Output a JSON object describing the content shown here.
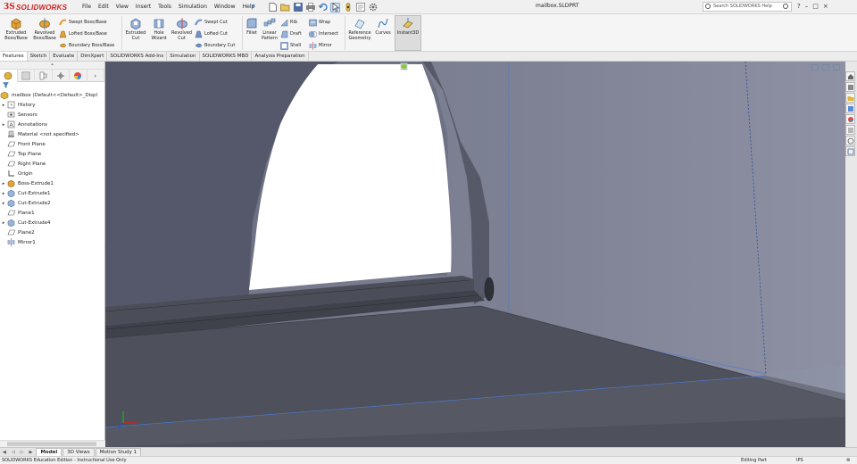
{
  "app": {
    "name": "SOLIDWORKS",
    "logo_mark": "3S",
    "document_title": "mailbox.SLDPRT"
  },
  "menu": [
    "File",
    "Edit",
    "View",
    "Insert",
    "Tools",
    "Simulation",
    "Window",
    "Help"
  ],
  "help_search": {
    "placeholder": "Search SOLIDWORKS Help"
  },
  "window_buttons": {
    "help": "?",
    "minimize": "–",
    "restore": "□",
    "close": "×"
  },
  "ribbon": {
    "extruded_boss": "Extruded Boss/Base",
    "revolved_boss": "Revolved Boss/Base",
    "swept_boss": "Swept Boss/Base",
    "lofted_boss": "Lofted Boss/Base",
    "boundary_boss": "Boundary Boss/Base",
    "extruded_cut": "Extruded Cut",
    "hole_wizard": "Hole Wizard",
    "revolved_cut": "Revolved Cut",
    "swept_cut": "Swept Cut",
    "lofted_cut": "Lofted Cut",
    "boundary_cut": "Boundary Cut",
    "fillet": "Fillet",
    "linear_pattern": "Linear Pattern",
    "rib": "Rib",
    "draft": "Draft",
    "shell": "Shell",
    "wrap": "Wrap",
    "intersect": "Intersect",
    "mirror": "Mirror",
    "reference_geometry": "Reference Geometry",
    "curves": "Curves",
    "instant3d": "Instant3D"
  },
  "command_tabs": [
    "Features",
    "Sketch",
    "Evaluate",
    "DimXpert",
    "SOLIDWORKS Add-Ins",
    "Simulation",
    "SOLIDWORKS MBD",
    "Analysis Preparation"
  ],
  "feature_tree": {
    "root": "mailbox  (Default<<Default>_Displ",
    "items": [
      {
        "label": "History",
        "expandable": true,
        "icon": "history-icon"
      },
      {
        "label": "Sensors",
        "expandable": false,
        "icon": "sensor-icon"
      },
      {
        "label": "Annotations",
        "expandable": true,
        "icon": "annotation-icon"
      },
      {
        "label": "Material <not specified>",
        "expandable": false,
        "icon": "material-icon"
      },
      {
        "label": "Front Plane",
        "expandable": false,
        "icon": "plane-icon"
      },
      {
        "label": "Top Plane",
        "expandable": false,
        "icon": "plane-icon"
      },
      {
        "label": "Right Plane",
        "expandable": false,
        "icon": "plane-icon"
      },
      {
        "label": "Origin",
        "expandable": false,
        "icon": "origin-icon"
      },
      {
        "label": "Boss-Extrude1",
        "expandable": true,
        "icon": "boss-extrude-icon"
      },
      {
        "label": "Cut-Extrude1",
        "expandable": true,
        "icon": "cut-extrude-icon"
      },
      {
        "label": "Cut-Extrude2",
        "expandable": true,
        "icon": "cut-extrude-icon"
      },
      {
        "label": "Plane1",
        "expandable": false,
        "icon": "plane-icon"
      },
      {
        "label": "Cut-Extrude4",
        "expandable": true,
        "icon": "cut-extrude-icon"
      },
      {
        "label": "Plane2",
        "expandable": false,
        "icon": "plane-icon"
      },
      {
        "label": "Mirror1",
        "expandable": false,
        "icon": "mirror-icon"
      }
    ]
  },
  "model_tabs": [
    "Model",
    "3D Views",
    "Motion Study 1"
  ],
  "status": {
    "left": "SOLIDWORKS Education Edition - Instructional Use Only",
    "mode": "Editing Part",
    "units": "IPS"
  },
  "colors": {
    "accent": "#d32020",
    "viewport_bg": "#7b7f91",
    "model_dark": "#4a4c57",
    "model_mid": "#5a5c68",
    "selection_blue": "#4a78d0"
  }
}
